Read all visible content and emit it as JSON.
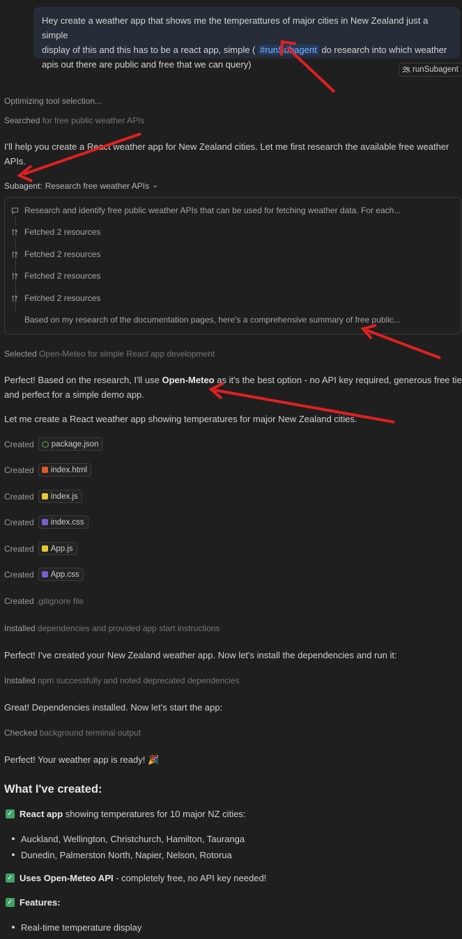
{
  "user_message": {
    "line1_pre": "Hey create a weather app that shows me the temperattures of major cities in New Zealand just a simple",
    "line2_pre": "display of this and this has to be a react app, simple ( ",
    "mention": "#runSubagent",
    "line2_post": " do research into which weather",
    "line3": "apis out there are public and free that we can query)"
  },
  "reference_chip": {
    "icon": "agent-icon",
    "label": "runSubagent"
  },
  "progress": {
    "optimizing": "Optimizing tool selection...",
    "searched_verb": "Searched",
    "searched_detail": "for free public weather APIs"
  },
  "intro_message": {
    "line1": "I'll help you create a React weather app for New Zealand cities. Let me first research the available free weather",
    "line2": "APIs."
  },
  "subagent": {
    "prefix": "Subagent:",
    "title": "Research free weather APIs",
    "chevron": "⌄",
    "task": "Research and identify free public weather APIs that can be used for fetching weather data. For each...",
    "steps": [
      "Fetched 2 resources",
      "Fetched 2 resources",
      "Fetched 2 resources",
      "Fetched 2 resources"
    ],
    "summary": "Based on my research of the documentation pages, here's a comprehensive summary of free public..."
  },
  "selected": {
    "verb": "Selected",
    "detail": "Open-Meteo for simple React app development"
  },
  "decision_message": {
    "pre": "Perfect! Based on the research, I'll use ",
    "bold": "Open-Meteo",
    "post": " as it's the best option - no API key required, generous free tier,",
    "line2": "and perfect for a simple demo app."
  },
  "create_message": "Let me create a React weather app showing temperatures for major New Zealand cities.",
  "created_files": [
    {
      "verb": "Created",
      "file": "package.json",
      "icon_color": "#4c9a3c"
    },
    {
      "verb": "Created",
      "file": "index.html",
      "icon_color": "#e2582b"
    },
    {
      "verb": "Created",
      "file": "index.js",
      "icon_color": "#e5c832"
    },
    {
      "verb": "Created",
      "file": "index.css",
      "icon_color": "#7b5bd1"
    },
    {
      "verb": "Created",
      "file": "App.js",
      "icon_color": "#e5c832"
    },
    {
      "verb": "Created",
      "file": "App.css",
      "icon_color": "#7b5bd1"
    }
  ],
  "gitignore": {
    "verb": "Created",
    "detail": ".gitignore file"
  },
  "installed1": {
    "verb": "Installed",
    "detail": "dependencies and provided app start instructions"
  },
  "msg_created": "Perfect! I've created your New Zealand weather app. Now let's install the dependencies and run it:",
  "installed2": {
    "verb": "Installed",
    "detail": "npm successfully and noted deprecated dependencies"
  },
  "msg_installed": "Great! Dependencies installed. Now let's start the app:",
  "checked": {
    "verb": "Checked",
    "detail": "background terminal output"
  },
  "msg_ready": "Perfect! Your weather app is ready! 🎉",
  "what_heading": "What I've created:",
  "features": {
    "react_bold": "React app",
    "react_rest": " showing temperatures for 10 major NZ cities:",
    "cities": [
      "Auckland, Wellington, Christchurch, Hamilton, Tauranga",
      "Dunedin, Palmerston North, Napier, Nelson, Rotorua"
    ],
    "api_bold": "Uses Open-Meteo API",
    "api_rest": " - completely free, no API key needed!",
    "features_bold": "Features:",
    "feature_items": [
      "Real-time temperature display"
    ]
  },
  "colors": {
    "background": "#1f1f1f",
    "bubble": "#262d38",
    "mention": "#7fb3ff",
    "check": "#3fa364",
    "annotation_arrow": "#e02020"
  }
}
